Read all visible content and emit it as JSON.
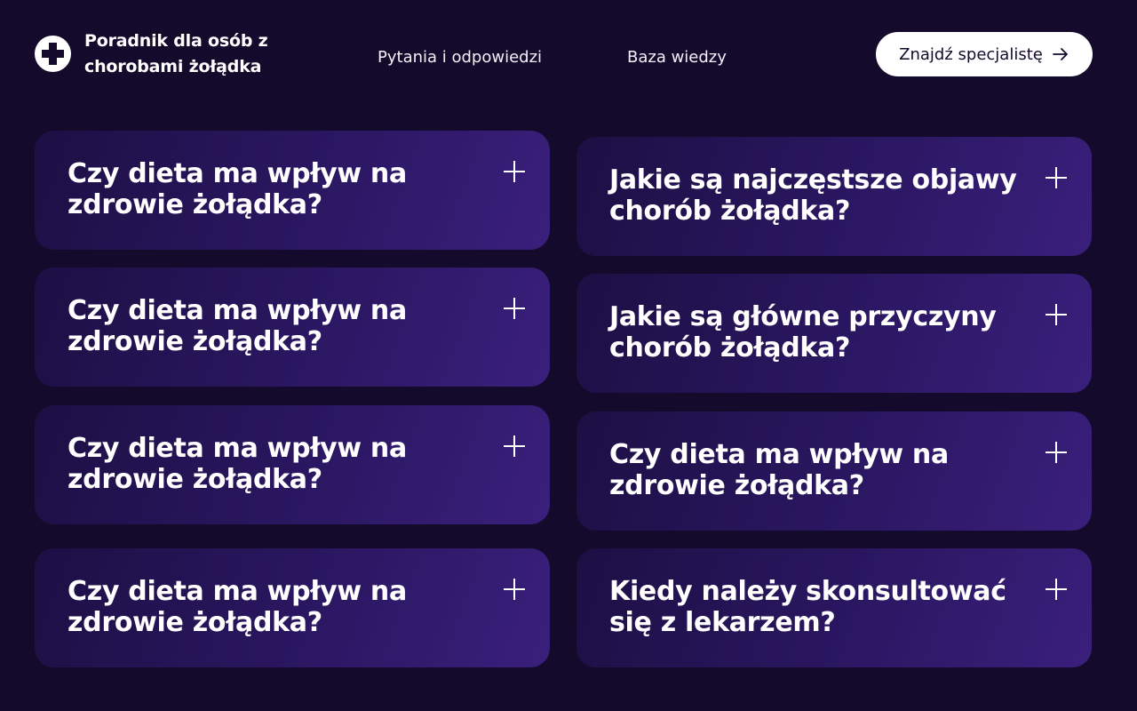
{
  "header": {
    "brand": "Poradnik dla osób z chorobami żołądka",
    "nav": [
      {
        "label": "Pytania i odpowiedzi"
      },
      {
        "label": "Baza wiedzy"
      }
    ],
    "cta_label": "Znajdź specjalistę"
  },
  "faq": {
    "left": [
      {
        "question": "Czy dieta ma wpływ na zdrowie żołądka?"
      },
      {
        "question": "Czy dieta ma wpływ na zdrowie żołądka?"
      },
      {
        "question": "Czy dieta ma wpływ na zdrowie żołądka?"
      },
      {
        "question": "Czy dieta ma wpływ na zdrowie żołądka?"
      }
    ],
    "right": [
      {
        "question": "Jakie są najczęstsze objawy chorób żołądka?"
      },
      {
        "question": "Jakie są główne przyczyny chorób żołądka?"
      },
      {
        "question": "Czy dieta ma wpływ na zdrowie żołądka?"
      },
      {
        "question": "Kiedy należy skonsultować się z lekarzem?"
      }
    ]
  },
  "icons": {
    "logo": "medical-cross-icon",
    "cta": "arrow-right-icon",
    "expand": "plus-icon"
  },
  "colors": {
    "background": "#140a2b",
    "card_start": "#1d0f44",
    "card_end": "#3a1f7c",
    "cta_background": "#ffffff",
    "cta_text": "#140a2b"
  }
}
